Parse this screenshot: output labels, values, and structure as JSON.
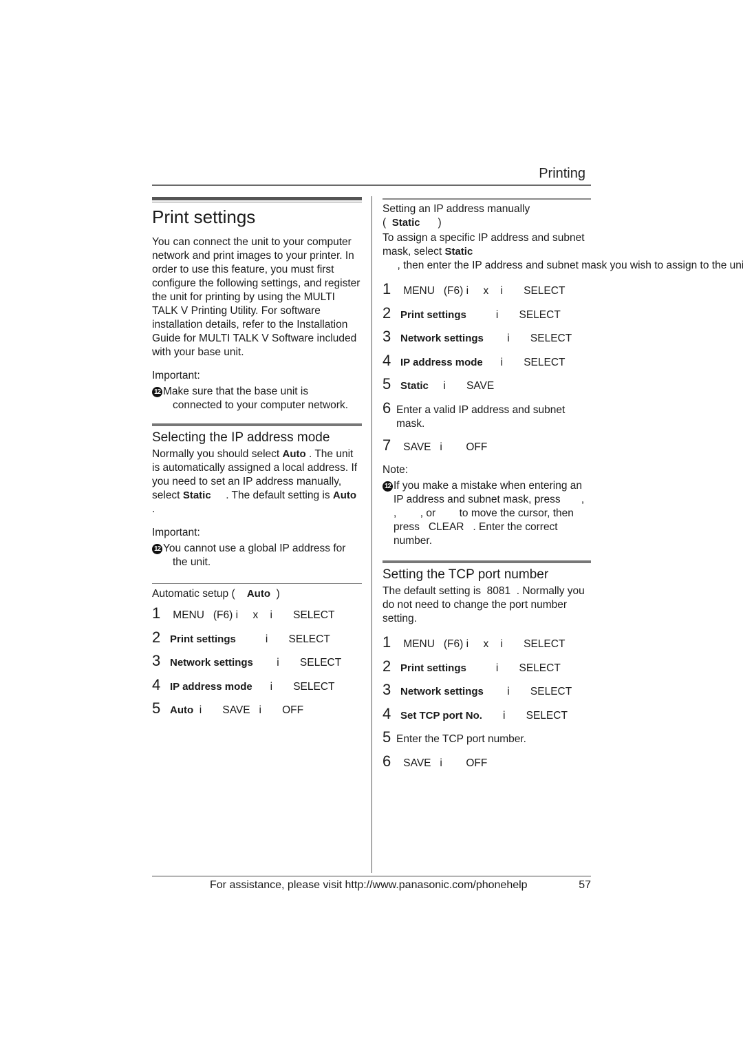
{
  "header": {
    "running_head": "Printing"
  },
  "footer": {
    "assistance_text": "For assistance, please visit http://www.panasonic.com/phonehelp",
    "page_number": "57"
  },
  "left_column": {
    "title": "Print settings",
    "intro": "You can connect the unit to your computer network and print images to your printer. In order to use this feature, you must first configure the following settings, and register the unit for printing by using the MULTI TALK V Printing Utility. For software installation details, refer to the  Installation Guide for MULTI TALK V Software included with your base unit.",
    "important_label": "Important:",
    "important_bullet_icon": "12",
    "important_text_1": "Make sure that the base unit is",
    "important_text_2": "connected to your computer network.",
    "section_title": "Selecting the IP address mode",
    "section_para": {
      "p1": "Normally you should select ",
      "auto1": "Auto",
      "p2": " . The unit is automatically assigned a local address. If you need to set an IP address manually, select ",
      "static": "Static",
      "p3": "     . The default setting is ",
      "auto2": "Auto",
      "p4": " ."
    },
    "important2_label": "Important:",
    "important2_text_1": "You cannot use a global IP address for",
    "important2_text_2": "the unit.",
    "auto_setup": {
      "heading_prefix": "Automatic setup (    ",
      "heading_bold": "Auto",
      "heading_suffix": "  )",
      "steps": [
        {
          "num": "1",
          "bold": "",
          "rest": " MENU   (F6) i     x    i       SELECT"
        },
        {
          "num": "2",
          "bold": "Print settings",
          "rest": "          i       SELECT"
        },
        {
          "num": "3",
          "bold": "Network settings",
          "rest": "        i       SELECT"
        },
        {
          "num": "4",
          "bold": "IP address mode",
          "rest": "      i       SELECT"
        },
        {
          "num": "5",
          "bold": "Auto",
          "rest": "  i       SAVE   i       OFF"
        }
      ]
    }
  },
  "right_column": {
    "manual_heading": "Setting an IP address manually",
    "manual_heading_paren_open": "(  ",
    "manual_heading_bold": "Static",
    "manual_heading_paren_close": "      )",
    "manual_para": {
      "p1": "To assign a specific IP address and subnet mask, select  ",
      "static": "Static",
      "p2": "     , then enter the IP address and subnet mask you wish to assign to the unit."
    },
    "manual_steps": [
      {
        "num": "1",
        "bold": "",
        "rest": " MENU   (F6) i     x    i       SELECT"
      },
      {
        "num": "2",
        "bold": "Print settings",
        "rest": "          i       SELECT"
      },
      {
        "num": "3",
        "bold": "Network settings",
        "rest": "        i       SELECT"
      },
      {
        "num": "4",
        "bold": "IP address mode",
        "rest": "      i       SELECT"
      },
      {
        "num": "5",
        "bold": "Static",
        "rest": "     i       SAVE"
      },
      {
        "num": "6",
        "bold": "",
        "rest": "Enter a valid IP address and subnet mask."
      },
      {
        "num": "7",
        "bold": "",
        "rest": " SAVE   i        OFF"
      }
    ],
    "note_label": "Note:",
    "note_bullet_icon": "12",
    "note_text": "If you make a mistake when entering an IP address and subnet mask, press       ,        ,        , or        to move the cursor, then press   CLEAR   . Enter the correct number.",
    "tcp_title": "Setting the TCP port number",
    "tcp_para": "The default setting is  8081  . Normally you do not need to change the port number setting.",
    "tcp_steps": [
      {
        "num": "1",
        "bold": "",
        "rest": " MENU   (F6) i     x    i       SELECT"
      },
      {
        "num": "2",
        "bold": "Print settings",
        "rest": "          i       SELECT"
      },
      {
        "num": "3",
        "bold": "Network settings",
        "rest": "        i       SELECT"
      },
      {
        "num": "4",
        "bold": "Set TCP port No.",
        "rest": "       i       SELECT"
      },
      {
        "num": "5",
        "bold": "",
        "rest": "Enter the TCP port number."
      },
      {
        "num": "6",
        "bold": "",
        "rest": " SAVE   i        OFF"
      }
    ]
  }
}
